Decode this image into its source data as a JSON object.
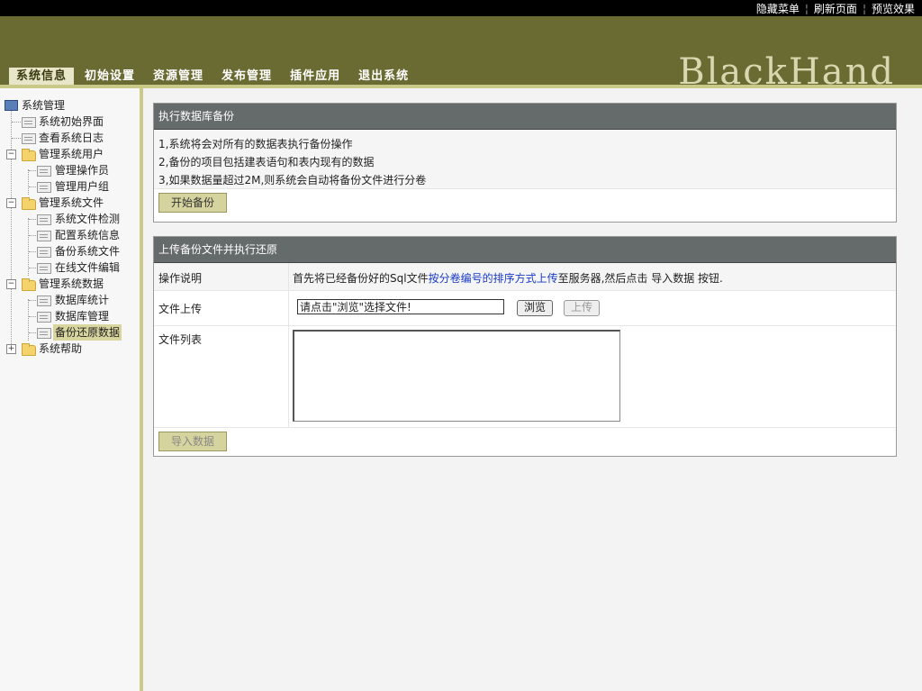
{
  "topbar": {
    "links": [
      "隐藏菜单",
      "刷新页面",
      "预览效果"
    ]
  },
  "brand": "BlackHand",
  "nav": {
    "tabs": [
      "系统信息",
      "初始设置",
      "资源管理",
      "发布管理",
      "插件应用",
      "退出系统"
    ],
    "active": 0
  },
  "sidebar": {
    "root": "系统管理",
    "items": {
      "init": "系统初始界面",
      "log": "查看系统日志",
      "users": "管理系统用户",
      "operator": "管理操作员",
      "usergroup": "管理用户组",
      "files": "管理系统文件",
      "filecheck": "系统文件检测",
      "config": "配置系统信息",
      "backupfiles": "备份系统文件",
      "onlineedit": "在线文件编辑",
      "data": "管理系统数据",
      "dbstats": "数据库统计",
      "dbmanage": "数据库管理",
      "dbrestore": "备份还原数据",
      "help": "系统帮助"
    }
  },
  "backup": {
    "title": "执行数据库备份",
    "notes": [
      "1,系统将会对所有的数据表执行备份操作",
      "2,备份的项目包括建表语句和表内现有的数据",
      "3,如果数据量超过2M,则系统会自动将备份文件进行分卷"
    ],
    "start_button": "开始备份"
  },
  "restore": {
    "title": "上传备份文件并执行还原",
    "instructions_label": "操作说明",
    "instructions_pre": "首先将已经备份好的Sql文件",
    "instructions_link": "按分卷编号的排序方式上传",
    "instructions_post": "至服务器,然后点击 导入数据 按钮.",
    "upload_label": "文件上传",
    "upload_value": "请点击\"浏览\"选择文件!",
    "browse_button": "浏览",
    "upload_button": "上传",
    "filelist_label": "文件列表",
    "import_button": "导入数据"
  }
}
